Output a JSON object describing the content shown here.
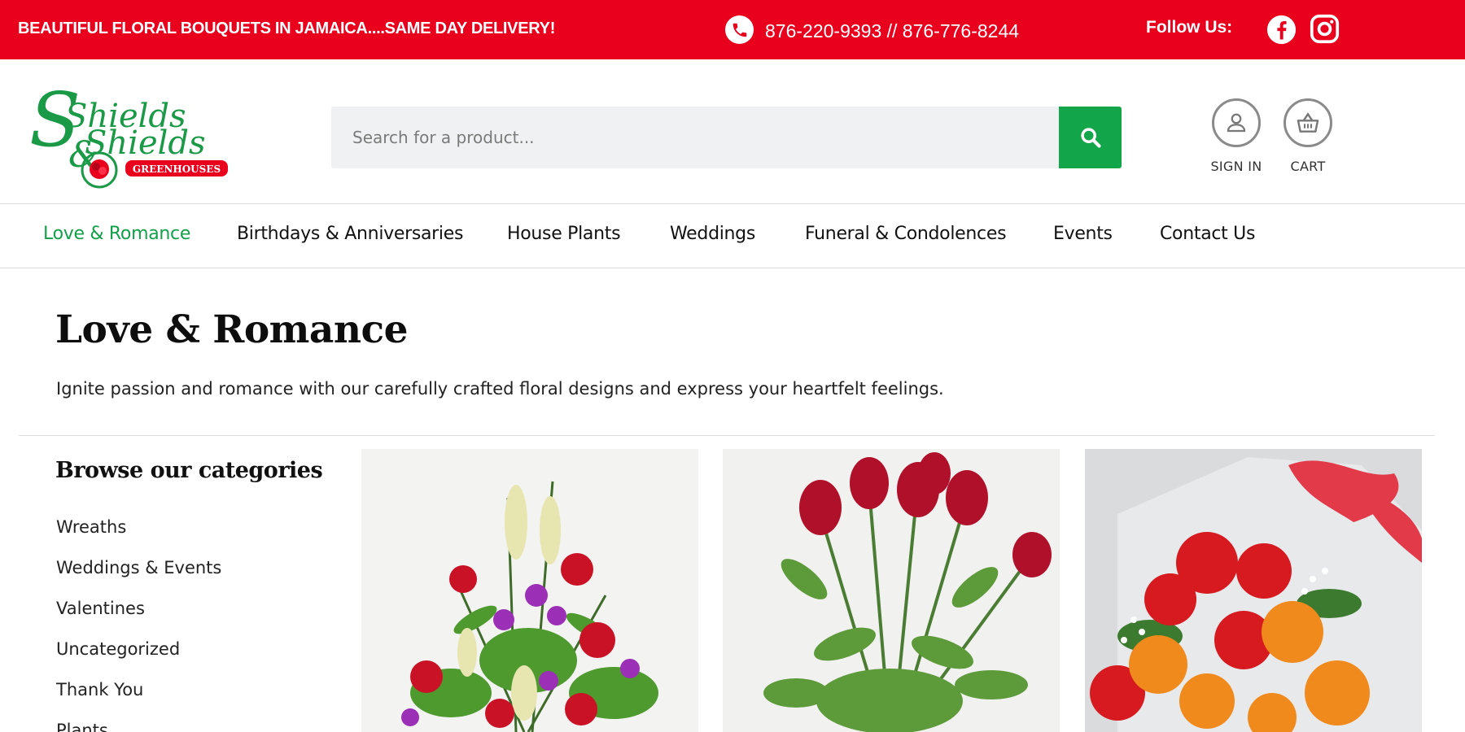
{
  "topbar": {
    "promo": "BEAUTIFUL FLORAL BOUQUETS IN JAMAICA....SAME DAY DELIVERY!",
    "phone": "876-220-9393 // 876-776-8244",
    "follow_label": "Follow Us:"
  },
  "header": {
    "logo": {
      "line1": "Shields",
      "line2": "Shields",
      "tag": "GREENHOUSES"
    },
    "search": {
      "placeholder": "Search for a product..."
    },
    "signin_label": "SIGN IN",
    "cart_label": "CART"
  },
  "nav": {
    "items": [
      {
        "label": "Love & Romance"
      },
      {
        "label": "Birthdays & Anniversaries"
      },
      {
        "label": "House Plants"
      },
      {
        "label": "Weddings"
      },
      {
        "label": "Funeral & Condolences"
      },
      {
        "label": "Events"
      },
      {
        "label": "Contact Us"
      }
    ]
  },
  "page": {
    "title": "Love & Romance",
    "description": "Ignite passion and romance with our carefully crafted floral designs and express your heartfelt feelings."
  },
  "sidebar": {
    "title": "Browse our categories",
    "items": [
      "Wreaths",
      "Weddings & Events",
      "Valentines",
      "Uncategorized",
      "Thank You",
      "Plants"
    ]
  },
  "colors": {
    "brand_red": "#e8001c",
    "brand_green": "#12a54a",
    "active_nav": "#13a04a"
  }
}
